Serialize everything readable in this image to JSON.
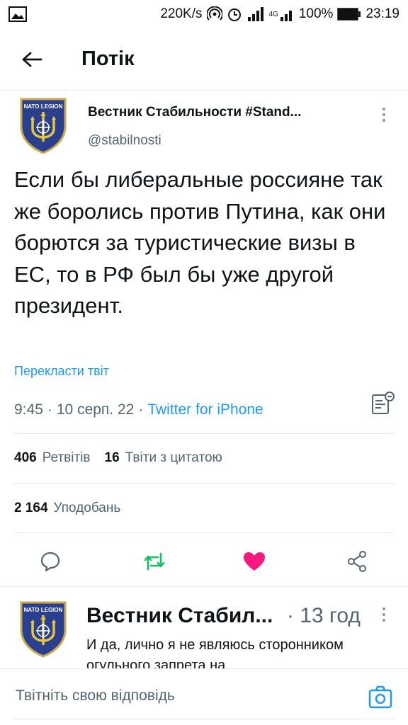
{
  "status_bar": {
    "speed": "220K/s",
    "network": "4G",
    "battery": "100%",
    "time": "23:19"
  },
  "header": {
    "title": "Потік"
  },
  "tweet": {
    "author_name": "Вестник Стабильности #Stand...",
    "handle": "@stabilnosti",
    "avatar_label": "NATO LEGION",
    "text": "Если бы либеральные россияне так же боролись против Путина, как они борются за туристические визы в ЕС, то в РФ был бы уже другой президент.",
    "translate_label": "Перекласти твіт",
    "time": "9:45",
    "date": "10 серп. 22",
    "separator": "·",
    "source": "Twitter for iPhone",
    "retweets_count": "406",
    "retweets_label": "Ретвітів",
    "quotes_count": "16",
    "quotes_label": "Твіти з цитатою",
    "likes_count": "2 164",
    "likes_label": "Уподобань"
  },
  "reply": {
    "author_name": "Вестник Стабил...",
    "time": "· 13 год",
    "text": "И да, лично я не являюсь сторонником огульного запрета на"
  },
  "composer": {
    "placeholder": "Твітніть свою відповідь"
  },
  "icons": {
    "reply": "speech-bubble-icon",
    "retweet": "retweet-icon",
    "like": "heart-icon",
    "share": "share-icon",
    "camera": "camera-icon",
    "back": "arrow-left-icon",
    "analytics": "analytics-icon"
  },
  "colors": {
    "accent": "#1d9bf0",
    "retweet": "#17bf63",
    "like": "#f91880",
    "text": "#0f1419",
    "secondary": "#536471",
    "avatar_bg": "#2b3f8f",
    "avatar_gold": "#e8c440"
  }
}
